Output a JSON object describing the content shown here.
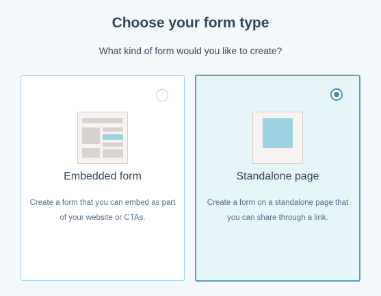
{
  "header": {
    "title": "Choose your form type",
    "subtitle": "What kind of form would you like to create?"
  },
  "options": [
    {
      "label": "Embedded form",
      "description": "Create a form that you can embed as part of your website or CTAs.",
      "selected": false
    },
    {
      "label": "Standalone page",
      "description": "Create a form on a standalone page that you can share through a link.",
      "selected": true
    }
  ],
  "colors": {
    "text": "#33475b",
    "muted": "#516f90",
    "selected_border": "#5a9fb8",
    "selected_bg": "#e5f5f8",
    "accent": "#9bd3e2"
  },
  "icons": {
    "embedded": "embedded-form-illustration",
    "standalone": "standalone-page-illustration"
  }
}
